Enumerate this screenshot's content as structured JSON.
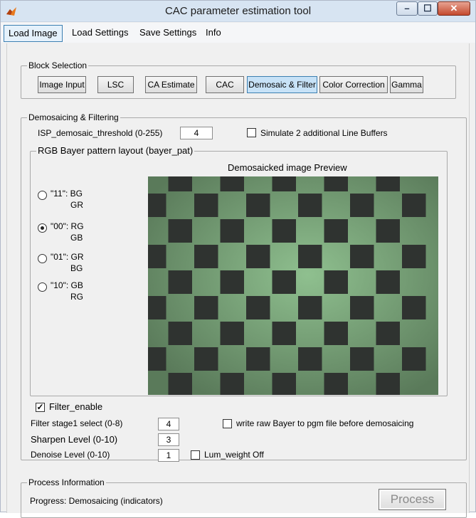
{
  "window": {
    "title": "CAC parameter estimation tool",
    "min_glyph": "–",
    "max_glyph": "☐",
    "close_glyph": "✕"
  },
  "menu": [
    "Load Image",
    "Load Settings",
    "Save Settings",
    "Info"
  ],
  "block_selection": {
    "title": "Block Selection",
    "buttons": [
      "Image Input",
      "LSC",
      "CA Estimate",
      "CAC",
      "Demosaic & Filter",
      "Color Correction",
      "Gamma"
    ],
    "selected": "Demosaic & Filter"
  },
  "demosaicing": {
    "title": "Demosaicing & Filtering",
    "threshold_label": "ISP_demosaic_threshold (0-255)",
    "threshold_value": "4",
    "line_buffers_label": "Simulate 2 additional Line Buffers",
    "line_buffers_checked": false,
    "bayer_group_title": "RGB Bayer pattern layout (bayer_pat)",
    "bayer_options": [
      {
        "code": "\"11\": BG",
        "line2": "GR",
        "selected": false
      },
      {
        "code": "\"00\": RG",
        "line2": "GB",
        "selected": true
      },
      {
        "code": "\"01\": GR",
        "line2": "BG",
        "selected": false
      },
      {
        "code": "\"10\": GB",
        "line2": "RG",
        "selected": false
      }
    ],
    "preview_title": "Demosaicked image Preview",
    "filter_enable_label": "Filter_enable",
    "filter_enable_checked": true,
    "check_glyph": "✓",
    "filter_stage_label": "Filter stage1 select (0-8)",
    "filter_stage_value": "4",
    "write_raw_label": "write raw Bayer to pgm file before demosaicing",
    "write_raw_checked": false,
    "sharpen_label": "Sharpen Level  (0-10)",
    "sharpen_value": "3",
    "denoise_label": "Denoise Level  (0-10)",
    "denoise_value": "1",
    "lum_weight_label": "Lum_weight Off",
    "lum_weight_checked": false
  },
  "process": {
    "title": "Process Information",
    "progress_text": "Progress: Demosaicing (indicators)",
    "process_label": "Process"
  },
  "colors": {
    "light_square": "#8fc08f",
    "dark_square": "#2f3330",
    "accent": "#3c7fb1"
  }
}
